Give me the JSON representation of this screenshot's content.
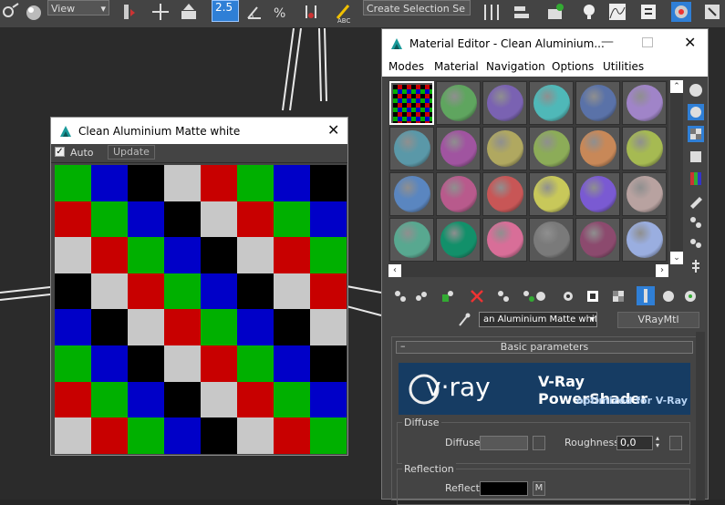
{
  "toolbar": {
    "view_select": "View",
    "snap_value": "2.5",
    "selection_set_select": "Create Selection Se",
    "abc_label": "ABC"
  },
  "preview": {
    "title": "Clean Aluminium Matte white",
    "auto_label": "Auto",
    "auto_checked": true,
    "update_label": "Update",
    "checker_colors": {
      "G": "#00b000",
      "B": "#0000c8",
      "K": "#000000",
      "W": "#c8c8c8",
      "R": "#c80000"
    },
    "checker_rows": [
      "GBKWRGBK",
      "RGBKWRGB",
      "WRGBKWRG",
      "KWRGBKWR",
      "BKWRGBKW",
      "GBKWRGBK",
      "RGBKWRGB",
      "WRGBKWRG"
    ]
  },
  "material_editor": {
    "title": "Material Editor - Clean Aluminium...",
    "menus": [
      "Modes",
      "Material",
      "Navigation",
      "Options",
      "Utilities"
    ],
    "slot_colors": [
      "checker",
      "#5fa55f",
      "#7a62b2",
      "#4fb8b8",
      "#5a72a8",
      "#a084c8",
      "#5a98a8",
      "#a054a0",
      "#b0a860",
      "#8cac58",
      "#c88858",
      "#a6ba52",
      "#5a86c0",
      "#b85a8c",
      "#c85656",
      "#c8c85a",
      "#7a5ad2",
      "#b8a2a0",
      "#58a890",
      "#12906a",
      "#d86e98",
      "#7a7a7a",
      "#8c4a6e",
      "#9aaee0"
    ],
    "material_name": "an Aluminium Matte white",
    "material_type": "VRayMtl",
    "rollout_title": "Basic parameters",
    "vray_banner": {
      "logo": "v·ray",
      "title": "V-Ray PowerShader",
      "subtitle": "optimized for V-Ray"
    },
    "diffuse_group": "Diffuse",
    "diffuse_label": "Diffuse",
    "roughness_label": "Roughness",
    "roughness_value": "0,0",
    "reflection_group": "Reflection",
    "reflect_label": "Reflect",
    "map_button": "M"
  }
}
